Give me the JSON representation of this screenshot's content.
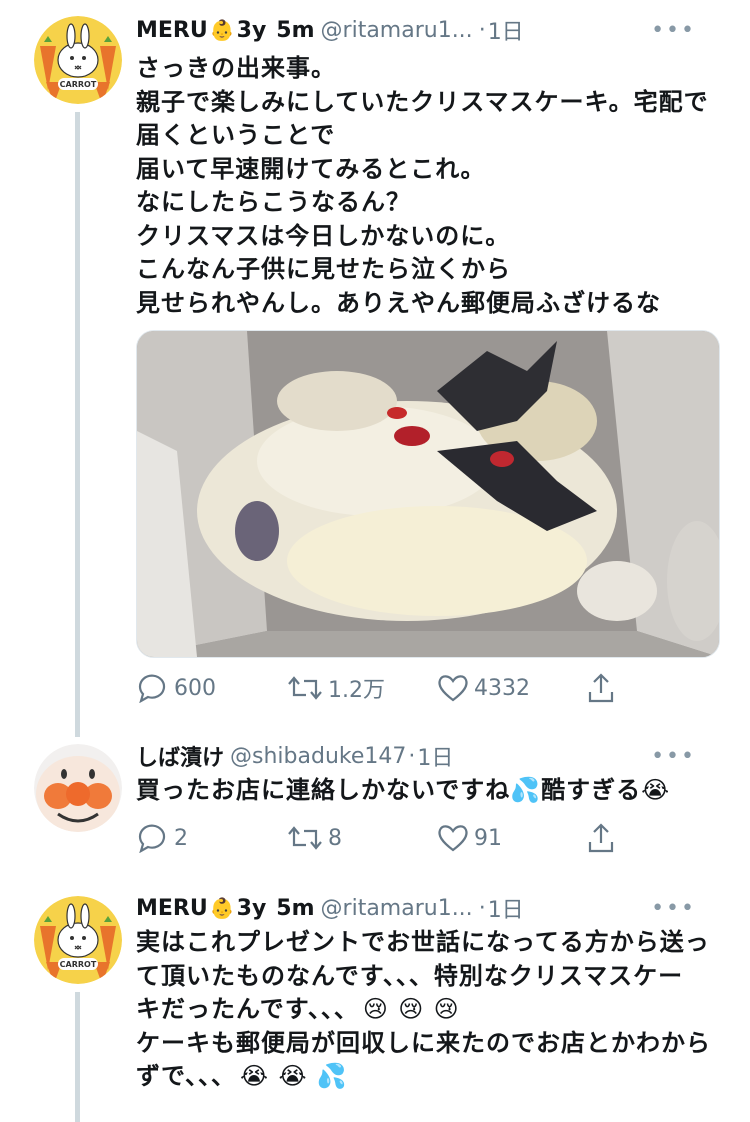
{
  "tweets": [
    {
      "name": "MERU",
      "name_emoji": "👶",
      "meta_a": "3y",
      "meta_b": "5m",
      "handle": "@ritamaru1...",
      "dot": "·",
      "time": "1日",
      "lines": [
        "さっきの出来事。",
        "親子で楽しみにしていたクリスマスケーキ。宅配で",
        "届くということで",
        "届いて早速開けてみるとこれ。",
        "なにしたらこうなるん？",
        "クリスマスは今日しかないのに。",
        "こんなん子供に見せたら泣くから",
        "見せられやんし。ありえやん郵便局ふざけるな"
      ],
      "replies": "600",
      "retweets": "1.2万",
      "likes": "4332"
    },
    {
      "name": "しば漬け",
      "handle": "@shibaduke147",
      "dot": "·",
      "time": "1日",
      "text_main": "買ったお店に連絡しかないですね",
      "text_emoji1": "💦",
      "text_tail": "酷すぎる",
      "text_emoji2": "😭",
      "replies": "2",
      "retweets": "8",
      "likes": "91"
    },
    {
      "name": "MERU",
      "name_emoji": "👶",
      "meta_a": "3y",
      "meta_b": "5m",
      "handle": "@ritamaru1...",
      "dot": "·",
      "time": "1日",
      "line1": "実はこれプレゼントでお世話になってる方から送っ",
      "line2": "て頂いたものなんです、、、特別なクリスマスケー",
      "line3_text": "キだったんです、、、",
      "line3_emoji": "😢 😢 😢",
      "line4": "ケーキも郵便局が回収しに来たのでお店とかわから",
      "line5_text": "ずで、、、",
      "line5_emoji": "😭 😭 💦"
    }
  ],
  "more_label": "•••",
  "colors": {
    "secondary_text": "#657786",
    "thread_line": "#cfd9de",
    "avatar_bg": "#f6d24a"
  }
}
